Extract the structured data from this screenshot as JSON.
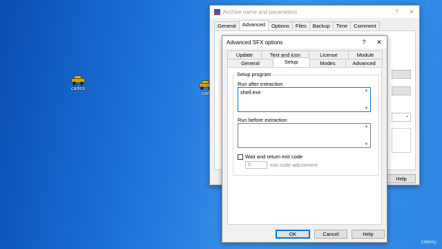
{
  "desktop": {
    "icons": [
      {
        "label": "carlico"
      },
      {
        "label": "carl"
      }
    ],
    "watermark": "Udemy"
  },
  "archive_window": {
    "title": "Archive name and parameters",
    "help_symbol": "?",
    "close_symbol": "✕",
    "tabs": [
      "General",
      "Advanced",
      "Options",
      "Files",
      "Backup",
      "Time",
      "Comment"
    ],
    "selected_tab": "Advanced",
    "help_button": "Help"
  },
  "sfx_dialog": {
    "title": "Advanced SFX options",
    "help_symbol": "?",
    "close_symbol": "✕",
    "tabs_row1": [
      "Update",
      "Text and icon",
      "License",
      "Module"
    ],
    "tabs_row2": [
      "General",
      "Setup",
      "Modes",
      "Advanced"
    ],
    "selected_tab": "Setup",
    "group_title": "Setup program",
    "run_after_label": "Run after extraction",
    "run_after_value": "shell.exe",
    "run_before_label": "Run before extraction",
    "run_before_value": "",
    "wait_checkbox_label": "Wait and return exit code",
    "wait_checked": false,
    "exit_code_value": "0",
    "exit_code_label": "exit code adjustment",
    "buttons": {
      "ok": "OK",
      "cancel": "Cancel",
      "help": "Help"
    }
  },
  "colors": {
    "focus": "#0078d7",
    "desktop": "#1a6fd6"
  }
}
